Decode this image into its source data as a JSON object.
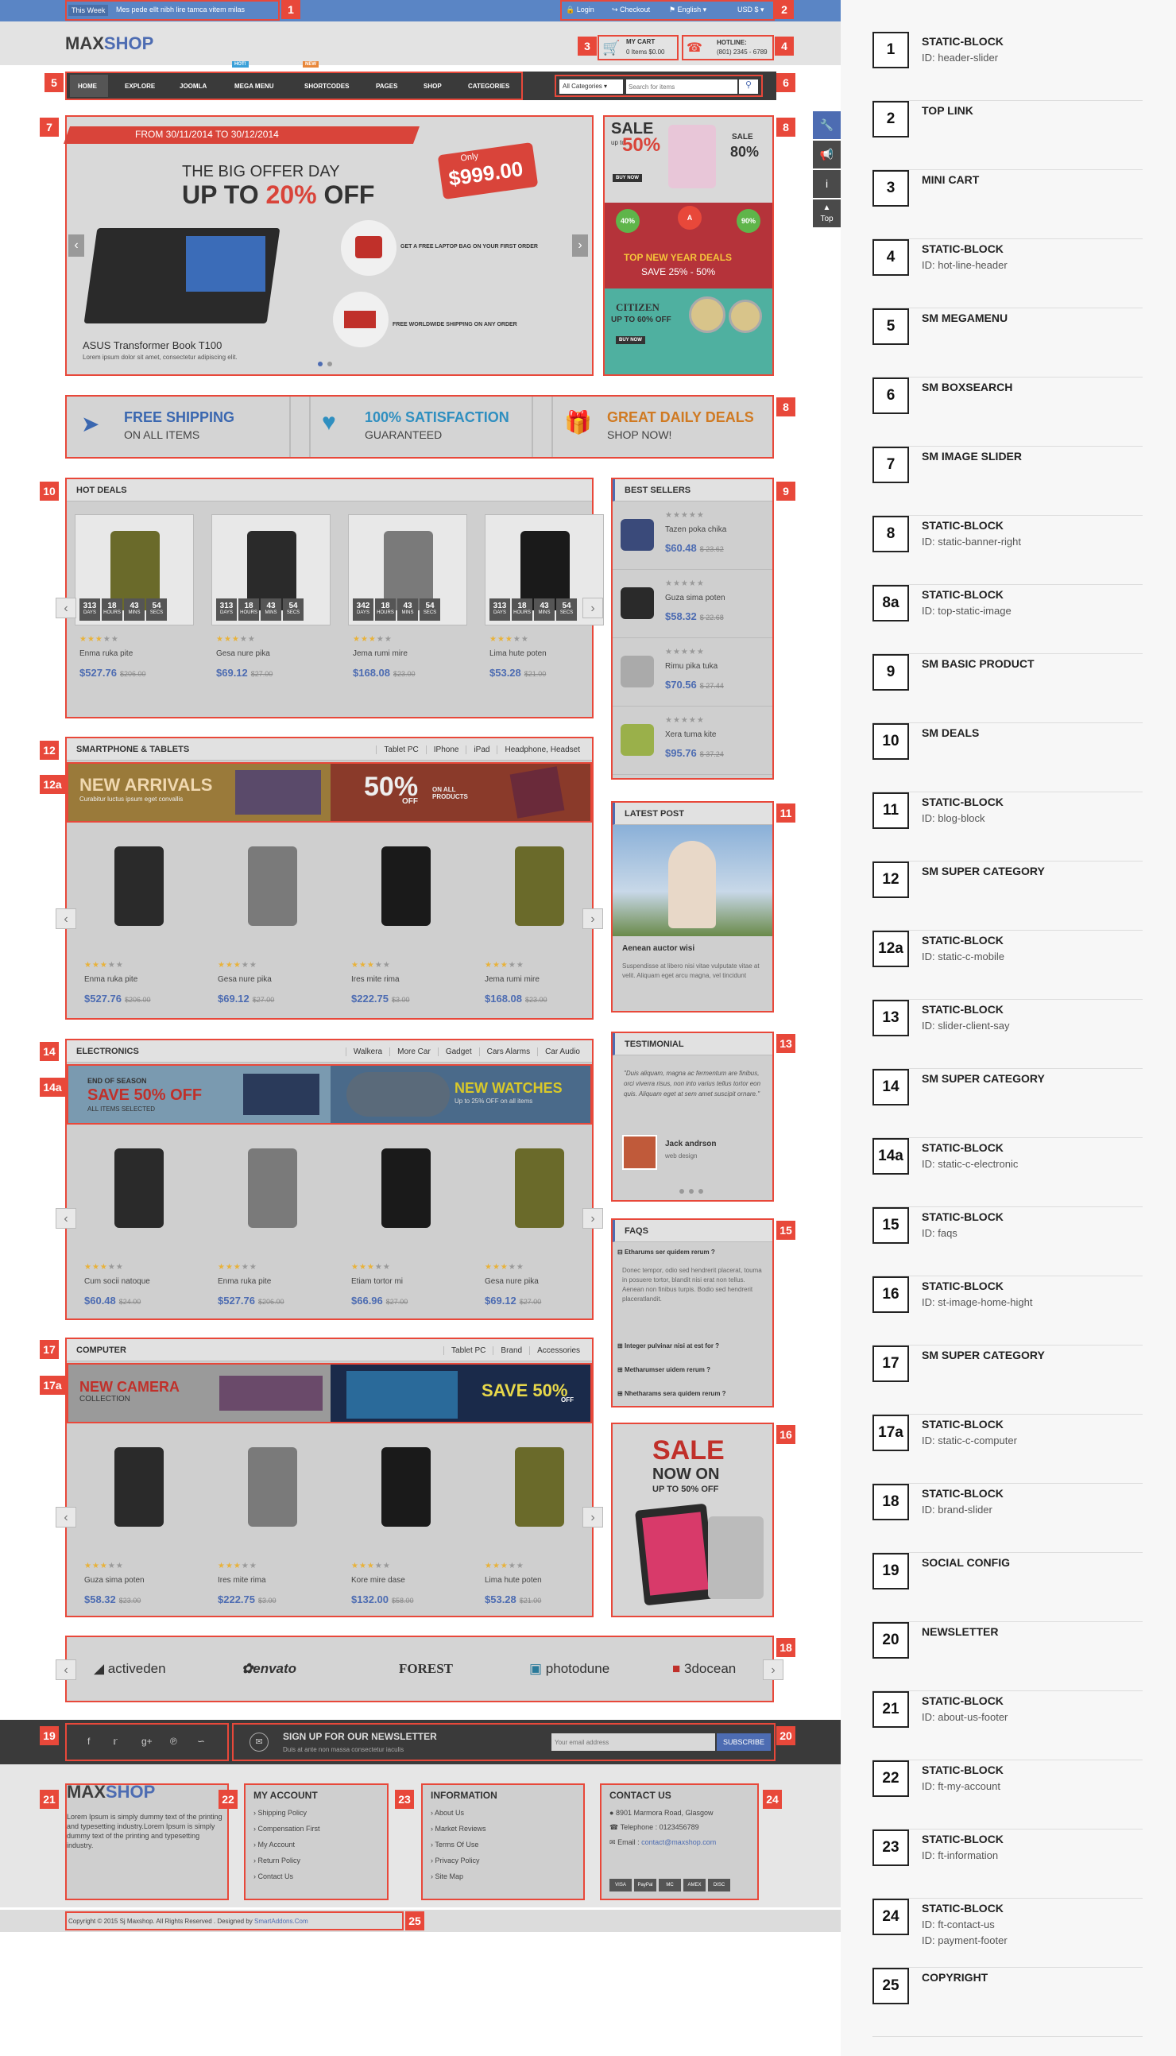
{
  "topbar": {
    "week": "This Week",
    "ticker": "Mes pede ellt nibh lire tamca vitem milas",
    "login": "Login",
    "checkout": "Checkout",
    "language": "English",
    "currency": "USD $"
  },
  "header": {
    "logo_max": "MAX",
    "logo_shop": "SHOP",
    "cart_title": "MY CART",
    "cart_items": "0 Items $0.00",
    "hotline_title": "HOTLINE:",
    "hotline_number": "(801) 2345 - 6789"
  },
  "nav": {
    "items": [
      "HOME",
      "EXPLORE",
      "JOOMLA",
      "MEGA MENU",
      "SHORTCODES",
      "PAGES",
      "SHOP",
      "CATEGORIES"
    ],
    "hot": "HOT!",
    "new": "NEW",
    "category_select": "All Categories",
    "search_placeholder": "Search for items"
  },
  "slider": {
    "date": "FROM 30/11/2014 TO 30/12/2014",
    "line1": "THE BIG OFFER DAY",
    "line2a": "UP TO ",
    "line2b": "20%",
    "line2c": " OFF",
    "only": "Only",
    "price": "$999.00",
    "feat1": "GET A FREE LAPTOP BAG ON YOUR FIRST ORDER",
    "feat2": "FREE WORLDWIDE SHIPPING ON ANY ORDER",
    "product": "ASUS Transformer Book T100",
    "desc": "Lorem ipsum dolor sit amet, consectetur adipiscing elit."
  },
  "banners": {
    "sale": "SALE",
    "up_to": "up to",
    "pct50": "50%",
    "sale2": "SALE",
    "pct80": "80%",
    "buy": "BUY NOW",
    "b40": "40%",
    "b90": "90%",
    "top_deals": "TOP NEW YEAR DEALS",
    "save_range": "SAVE 25% - 50%",
    "citizen": "CITIZEN",
    "citizen_off": "UP TO 60% OFF"
  },
  "features": [
    {
      "title": "FREE SHIPPING",
      "sub": "ON ALL ITEMS",
      "color": "#3a67b0"
    },
    {
      "title": "100% SATISFACTION",
      "sub": "GUARANTEED",
      "color": "#2f8fc0"
    },
    {
      "title": "GREAT DAILY DEALS",
      "sub": "SHOP NOW!",
      "color": "#d07a22"
    }
  ],
  "hot_deals": {
    "title": "HOT DEALS",
    "products": [
      {
        "name": "Enma ruka pite",
        "price": "$527.76",
        "old": "$206.00",
        "cd": [
          "313",
          "18",
          "43",
          "54"
        ]
      },
      {
        "name": "Gesa nure pika",
        "price": "$69.12",
        "old": "$27.00",
        "cd": [
          "313",
          "18",
          "43",
          "54"
        ]
      },
      {
        "name": "Jema rumi mire",
        "price": "$168.08",
        "old": "$23.00",
        "cd": [
          "342",
          "18",
          "43",
          "54"
        ]
      },
      {
        "name": "Lima hute poten",
        "price": "$53.28",
        "old": "$21.00",
        "cd": [
          "313",
          "18",
          "43",
          "54"
        ]
      }
    ],
    "cd_labels": [
      "DAYS",
      "HOURS",
      "MINS",
      "SECS"
    ]
  },
  "best_sellers": {
    "title": "BEST SELLERS",
    "items": [
      {
        "name": "Tazen poka chika",
        "price": "$60.48",
        "old": "$ 23.62"
      },
      {
        "name": "Guza sima poten",
        "price": "$58.32",
        "old": "$ 22.68"
      },
      {
        "name": "Rimu pika tuka",
        "price": "$70.56",
        "old": "$ 27.44"
      },
      {
        "name": "Xera tuma kite",
        "price": "$95.76",
        "old": "$ 37.24"
      }
    ]
  },
  "smartphone": {
    "title": "SMARTPHONE & TABLETS",
    "tabs": [
      "Tablet PC",
      "IPhone",
      "iPad",
      "Headphone, Headset"
    ],
    "banner_left": "NEW ARRIVALS",
    "banner_left_sub": "Curabitur luctus ipsum eget convallis",
    "banner_pct": "50%",
    "banner_off": "OFF",
    "banner_on_all": "ON ALL PRODUCTS",
    "products": [
      {
        "name": "Enma ruka pite",
        "price": "$527.76",
        "old": "$206.00"
      },
      {
        "name": "Gesa nure pika",
        "price": "$69.12",
        "old": "$27.00"
      },
      {
        "name": "Ires mite rima",
        "price": "$222.75",
        "old": "$3.00"
      },
      {
        "name": "Jema rumi mire",
        "price": "$168.08",
        "old": "$23.00"
      }
    ]
  },
  "latest_post": {
    "title": "LATEST POST",
    "post_title": "Aenean auctor wisi",
    "post_text": "Suspendisse at libero nisi vitae vulputate vitae at velit. Aliquam eget arcu magna, vel tincidunt"
  },
  "electronics": {
    "title": "ELECTRONICS",
    "tabs": [
      "Walkera",
      "More Car",
      "Gadget",
      "Cars Alarms",
      "Car Audio"
    ],
    "b1": "END OF SEASON",
    "b2": "SAVE 50% OFF",
    "b3": "ALL ITEMS SELECTED",
    "b4": "NEW WATCHES",
    "b5": "Up to 25% OFF on all items",
    "products": [
      {
        "name": "Cum socii natoque",
        "price": "$60.48",
        "old": "$24.00"
      },
      {
        "name": "Enma ruka pite",
        "price": "$527.76",
        "old": "$206.00"
      },
      {
        "name": "Etiam tortor mi",
        "price": "$66.96",
        "old": "$27.00"
      },
      {
        "name": "Gesa nure pika",
        "price": "$69.12",
        "old": "$27.00"
      }
    ]
  },
  "testimonial": {
    "title": "TESTIMONIAL",
    "quote": "\"Duis aliquam, magna ac fermentum are finibus, orci viverra risus, non into varius tellus tortor eon quis. Aliquam eget at sem amet suscipit ornare.\"",
    "author": "Jack andrson",
    "role": "web design"
  },
  "faqs": {
    "title": "FAQS",
    "items": [
      "Etharums ser quidem rerum ?",
      "Integer pulvinar nisi at est for ?",
      "Metharumser uidem rerum ?",
      "Nhetharams sera quidem rerum ?"
    ],
    "answer": "Donec tempor, odio sed hendrerit placerat, touma in posuere tortor, blandit nisi erat non tellus. Aenean non finibus turpis. Bodio sed hendrerit placeratlandit."
  },
  "computer": {
    "title": "COMPUTER",
    "tabs": [
      "Tablet PC",
      "Brand",
      "Accessories"
    ],
    "b1": "NEW CAMERA",
    "b2": "COLLECTION",
    "b3": "SAVE 50%",
    "b4": "OFF",
    "products": [
      {
        "name": "Guza sima poten",
        "price": "$58.32",
        "old": "$23.00"
      },
      {
        "name": "Ires mite rima",
        "price": "$222.75",
        "old": "$3.00"
      },
      {
        "name": "Kore mire dase",
        "price": "$132.00",
        "old": "$58.00"
      },
      {
        "name": "Lima hute poten",
        "price": "$53.28",
        "old": "$21.00"
      }
    ]
  },
  "sale_banner": {
    "sale": "SALE",
    "now_on": "NOW ON",
    "up_to": "UP TO 50% OFF"
  },
  "brands": [
    "activeden",
    "envato",
    "FOREST",
    "photodune",
    "3docean"
  ],
  "newsletter": {
    "title": "SIGN UP FOR OUR NEWSLETTER",
    "sub": "Duis at ante non massa consectetur iaculis",
    "placeholder": "Your email address",
    "button": "SUBSCRIBE"
  },
  "footer": {
    "about": "Lorem Ipsum is simply dummy text of the printing and typesetting industry.Lorem Ipsum is simply dummy text of the printing and typesetting industry.",
    "my_account": {
      "title": "MY ACCOUNT",
      "items": [
        "Shipping Policy",
        "Compensation First",
        "My Account",
        "Return Policy",
        "Contact Us"
      ]
    },
    "information": {
      "title": "INFORMATION",
      "items": [
        "About Us",
        "Market Reviews",
        "Terms Of Use",
        "Privacy Policy",
        "Site Map"
      ]
    },
    "contact": {
      "title": "CONTACT US",
      "address": "8901 Marmora Road, Glasgow",
      "phone": "Telephone : 0123456789",
      "email_label": "Email :",
      "email": "contact@maxshop.com"
    },
    "payments": [
      "VISA",
      "PayPal",
      "MC",
      "AMEX",
      "DISC"
    ]
  },
  "copyright": {
    "text": "Copyright © 2015 Sj Maxshop. All Rights Reserved . Designed by",
    "link": "SmartAddons.Com"
  },
  "sidetools": [
    "wrench-icon",
    "megaphone-icon",
    "info-icon",
    "top"
  ],
  "sidetool_top": "Top",
  "badges": {
    "b1": "1",
    "b2": "2",
    "b3": "3",
    "b4": "4",
    "b5": "5",
    "b6": "6",
    "b7": "7",
    "b8": "8",
    "b8b": "8",
    "b9": "9",
    "b10": "10",
    "b11": "11",
    "b12": "12",
    "b12a": "12a",
    "b13": "13",
    "b14": "14",
    "b14a": "14a",
    "b15": "15",
    "b16": "16",
    "b17": "17",
    "b17a": "17a",
    "b18": "18",
    "b19": "19",
    "b20": "20",
    "b21": "21",
    "b22": "22",
    "b23": "23",
    "b24": "24",
    "b25": "25"
  },
  "legend": [
    {
      "num": "1",
      "title": "STATIC-BLOCK",
      "id": "ID: header-slider"
    },
    {
      "num": "2",
      "title": "TOP LINK",
      "id": ""
    },
    {
      "num": "3",
      "title": "MINI CART",
      "id": ""
    },
    {
      "num": "4",
      "title": "STATIC-BLOCK",
      "id": "ID: hot-line-header"
    },
    {
      "num": "5",
      "title": "SM MEGAMENU",
      "id": ""
    },
    {
      "num": "6",
      "title": "SM BOXSEARCH",
      "id": ""
    },
    {
      "num": "7",
      "title": "SM IMAGE SLIDER",
      "id": ""
    },
    {
      "num": "8",
      "title": "STATIC-BLOCK",
      "id": "ID: static-banner-right"
    },
    {
      "num": "8a",
      "title": "STATIC-BLOCK",
      "id": "ID: top-static-image"
    },
    {
      "num": "9",
      "title": "SM BASIC PRODUCT",
      "id": ""
    },
    {
      "num": "10",
      "title": "SM DEALS",
      "id": ""
    },
    {
      "num": "11",
      "title": "STATIC-BLOCK",
      "id": "ID: blog-block"
    },
    {
      "num": "12",
      "title": "SM SUPER CATEGORY",
      "id": ""
    },
    {
      "num": "12a",
      "title": "STATIC-BLOCK",
      "id": "ID: static-c-mobile"
    },
    {
      "num": "13",
      "title": "STATIC-BLOCK",
      "id": "ID: slider-client-say"
    },
    {
      "num": "14",
      "title": "SM SUPER CATEGORY",
      "id": ""
    },
    {
      "num": "14a",
      "title": "STATIC-BLOCK",
      "id": "ID: static-c-electronic"
    },
    {
      "num": "15",
      "title": "STATIC-BLOCK",
      "id": "ID: faqs"
    },
    {
      "num": "16",
      "title": "STATIC-BLOCK",
      "id": "ID: st-image-home-hight"
    },
    {
      "num": "17",
      "title": "SM SUPER CATEGORY",
      "id": ""
    },
    {
      "num": "17a",
      "title": "STATIC-BLOCK",
      "id": "ID: static-c-computer"
    },
    {
      "num": "18",
      "title": "STATIC-BLOCK",
      "id": "ID: brand-slider"
    },
    {
      "num": "19",
      "title": "SOCIAL CONFIG",
      "id": ""
    },
    {
      "num": "20",
      "title": "NEWSLETTER",
      "id": ""
    },
    {
      "num": "21",
      "title": "STATIC-BLOCK",
      "id": "ID: about-us-footer"
    },
    {
      "num": "22",
      "title": "STATIC-BLOCK",
      "id": "ID: ft-my-account"
    },
    {
      "num": "23",
      "title": "STATIC-BLOCK",
      "id": "ID: ft-information"
    },
    {
      "num": "24",
      "title": "STATIC-BLOCK",
      "id": "ID: ft-contact-us\nID: payment-footer"
    },
    {
      "num": "25",
      "title": "COPYRIGHT",
      "id": ""
    }
  ]
}
